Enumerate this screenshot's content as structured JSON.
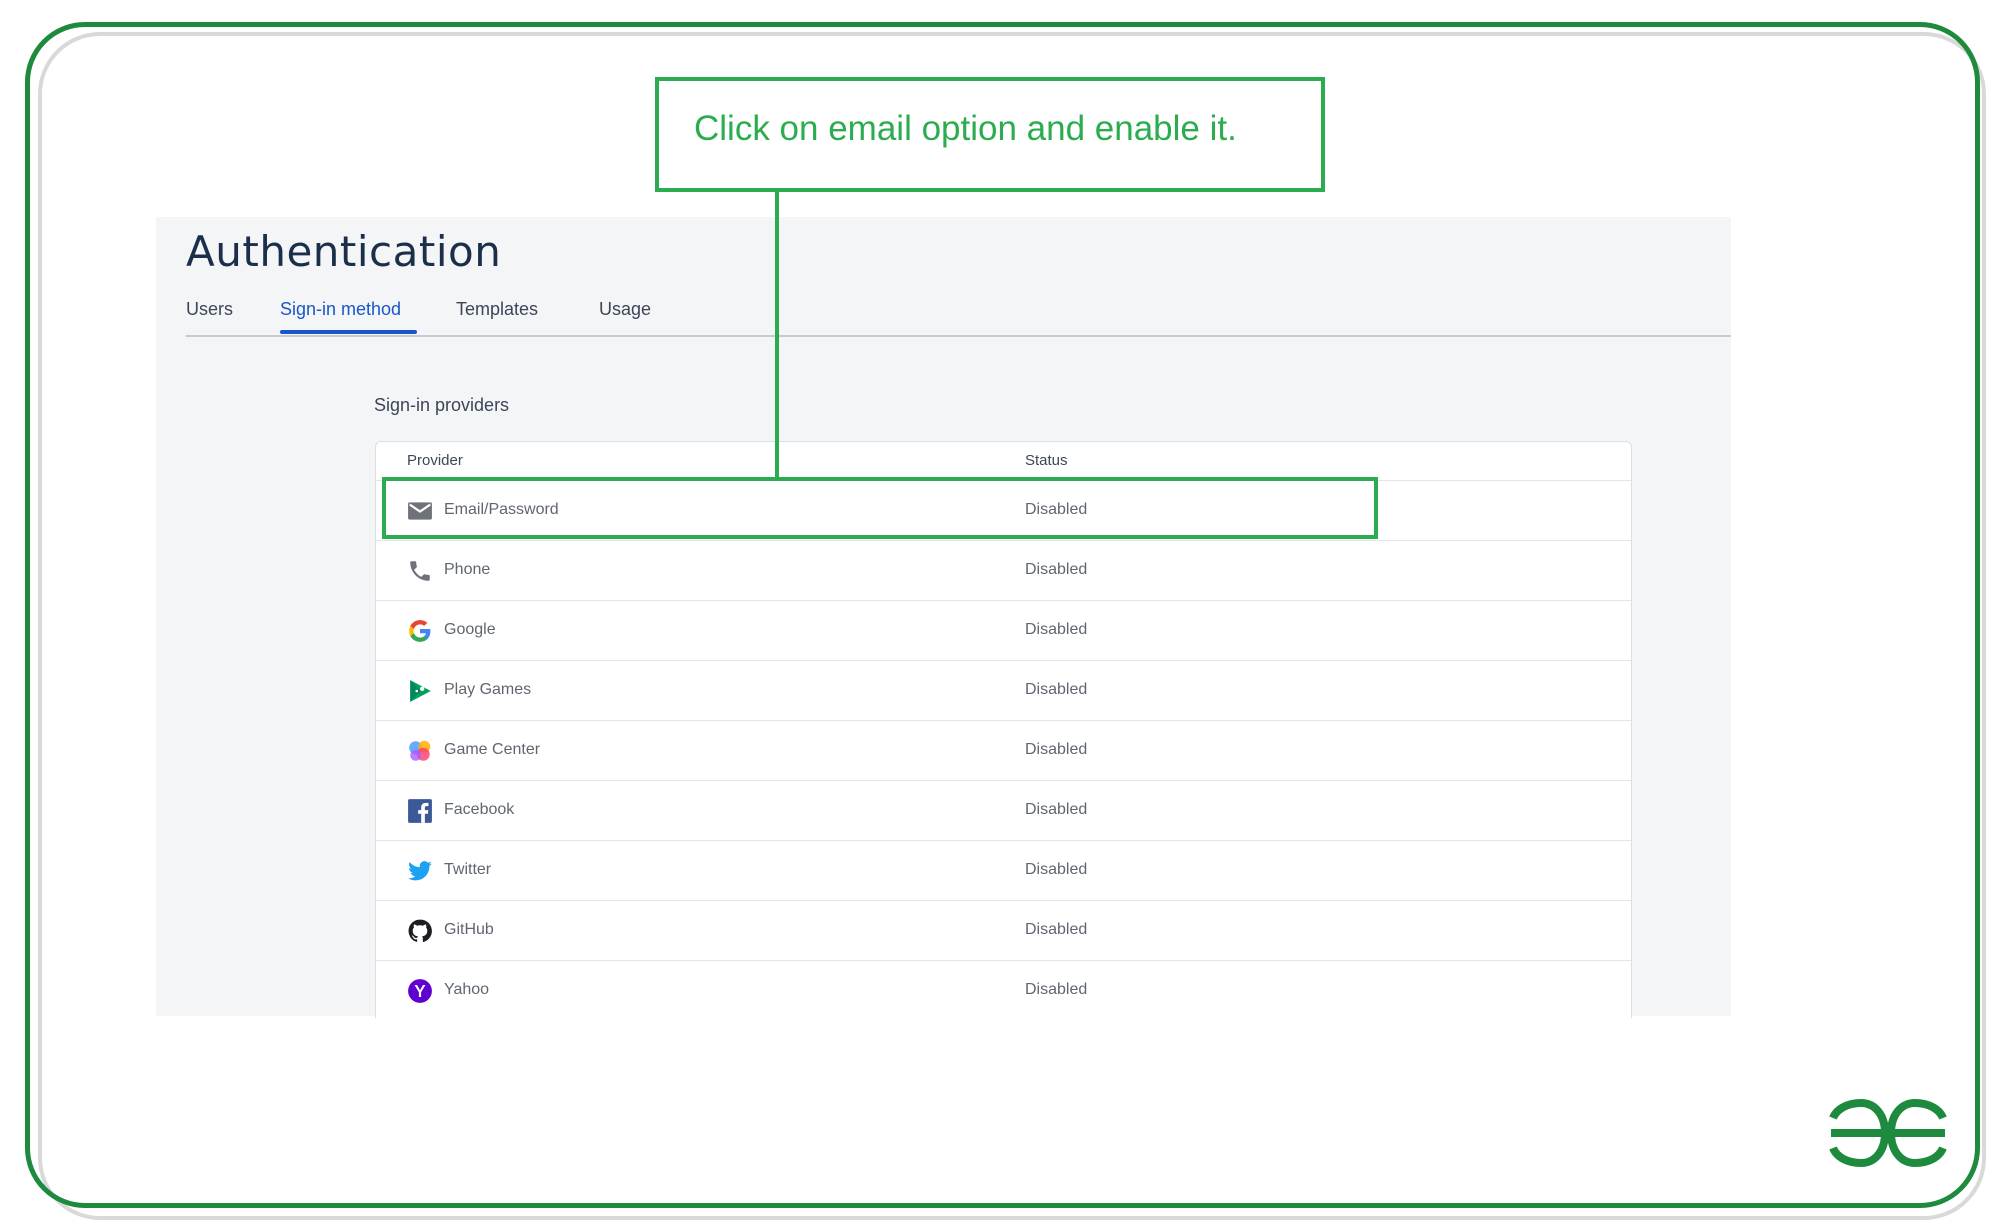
{
  "annotation": {
    "note": "Click on email option and enable it."
  },
  "page": {
    "title": "Authentication"
  },
  "tabs": [
    {
      "label": "Users",
      "active": false
    },
    {
      "label": "Sign-in method",
      "active": true
    },
    {
      "label": "Templates",
      "active": false
    },
    {
      "label": "Usage",
      "active": false
    }
  ],
  "providers": {
    "section_label": "Sign-in providers",
    "columns": {
      "provider": "Provider",
      "status": "Status"
    },
    "rows": [
      {
        "name": "Email/Password",
        "status": "Disabled",
        "icon": "mail-icon"
      },
      {
        "name": "Phone",
        "status": "Disabled",
        "icon": "phone-icon"
      },
      {
        "name": "Google",
        "status": "Disabled",
        "icon": "google-icon"
      },
      {
        "name": "Play Games",
        "status": "Disabled",
        "icon": "play-games-icon"
      },
      {
        "name": "Game Center",
        "status": "Disabled",
        "icon": "game-center-icon"
      },
      {
        "name": "Facebook",
        "status": "Disabled",
        "icon": "facebook-icon"
      },
      {
        "name": "Twitter",
        "status": "Disabled",
        "icon": "twitter-icon"
      },
      {
        "name": "GitHub",
        "status": "Disabled",
        "icon": "github-icon"
      },
      {
        "name": "Yahoo",
        "status": "Disabled",
        "icon": "yahoo-icon"
      }
    ]
  },
  "colors": {
    "annotation": "#2bad4f",
    "frame": "#1e8a3e",
    "active_tab": "#1a56c9",
    "title": "#1c2f4a"
  }
}
